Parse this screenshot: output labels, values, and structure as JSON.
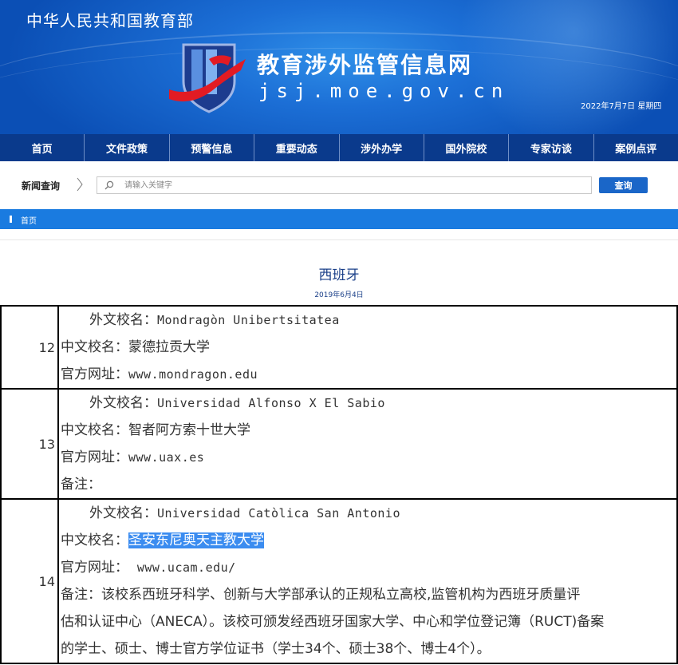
{
  "header": {
    "ministry": "中华人民共和国教育部",
    "site_title": "教育涉外监管信息网",
    "site_domain": "jsj.moe.gov.cn",
    "date": "2022年7月7日 星期四"
  },
  "nav": [
    "首页",
    "文件政策",
    "预警信息",
    "重要动态",
    "涉外办学",
    "国外院校",
    "专家访谈",
    "案例点评"
  ],
  "search": {
    "label": "新闻查询",
    "placeholder": "请输入关键字",
    "button": "查询"
  },
  "breadcrumb": "首页",
  "article": {
    "title": "西班牙",
    "date": "2019年6月4日"
  },
  "rows": [
    {
      "num": "12",
      "foreign_label": "外文校名：",
      "foreign_name": "Mondragòn Unibertsitatea",
      "cn_label": "中文校名：",
      "cn_name": "蒙德拉贡大学",
      "url_label": "官方网址：",
      "url": "www.mondragon.edu"
    },
    {
      "num": "13",
      "foreign_label": "外文校名：",
      "foreign_name": "Universidad Alfonso X El Sabio",
      "cn_label": "中文校名：",
      "cn_name": "智者阿方索十世大学",
      "url_label": "官方网址：",
      "url": "www.uax.es",
      "note_label": "备注："
    },
    {
      "num": "14",
      "foreign_label": "外文校名：",
      "foreign_name": "Universidad Catòlica San Antonio",
      "cn_label": "中文校名：",
      "cn_name": "圣安东尼奥天主教大学",
      "url_label": "官方网址：",
      "url": "www.ucam.edu/",
      "note_label": "备注：",
      "note_line1": "该校系西班牙科学、创新与大学部承认的正规私立高校,监管机构为西班牙质量评",
      "note_line2": "估和认证中心（ANECA）。该校可颁发经西班牙国家大学、中心和学位登记簿（RUCT)备案",
      "note_line3": "的学士、硕士、博士官方学位证书（学士34个、硕士38个、博士4个）。"
    }
  ],
  "colors": {
    "nav_bg": "#0a3a8c",
    "breadcrumb_bg": "#1a7be0",
    "button_bg": "#1a66c8",
    "title_color": "#1a3f88",
    "highlight": "#3b8cf0"
  }
}
